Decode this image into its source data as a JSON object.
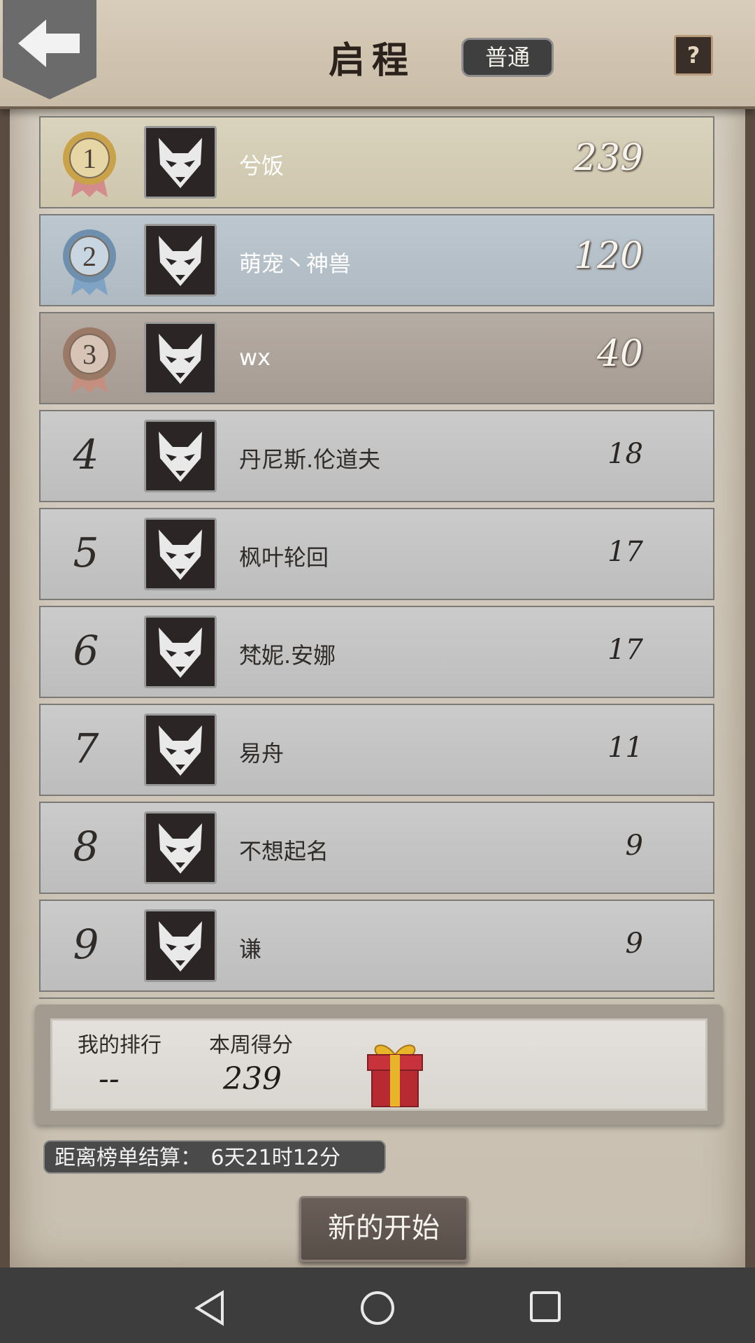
{
  "header": {
    "title": "启程",
    "mode": "普通",
    "help": "?"
  },
  "leaderboard": [
    {
      "rank": "1",
      "name": "兮饭",
      "score": "239",
      "tier": "gold"
    },
    {
      "rank": "2",
      "name": "萌宠丶神兽",
      "score": "120",
      "tier": "silver"
    },
    {
      "rank": "3",
      "name": "wx",
      "score": "40",
      "tier": "bronze"
    },
    {
      "rank": "4",
      "name": "丹尼斯.伦道夫",
      "score": "18"
    },
    {
      "rank": "5",
      "name": "枫叶轮回",
      "score": "17"
    },
    {
      "rank": "6",
      "name": "梵妮.安娜",
      "score": "17"
    },
    {
      "rank": "7",
      "name": "易舟",
      "score": "11"
    },
    {
      "rank": "8",
      "name": "不想起名",
      "score": "9"
    },
    {
      "rank": "9",
      "name": "谦",
      "score": "9"
    }
  ],
  "my_stats": {
    "rank_label": "我的排行",
    "rank_value": "--",
    "score_label": "本周得分",
    "score_value": "239"
  },
  "countdown": {
    "label": "距离榜单结算：",
    "value": "6天21时12分"
  },
  "start_button": "新的开始",
  "icons": {
    "back": "back-arrow-icon",
    "avatar": "wolf-icon",
    "gift": "gift-box-icon"
  },
  "colors": {
    "gold_row": "#dad3bd",
    "silver_row": "#bcc7cf",
    "bronze_row": "#b5aca4",
    "normal_row": "#cbcbcb"
  }
}
